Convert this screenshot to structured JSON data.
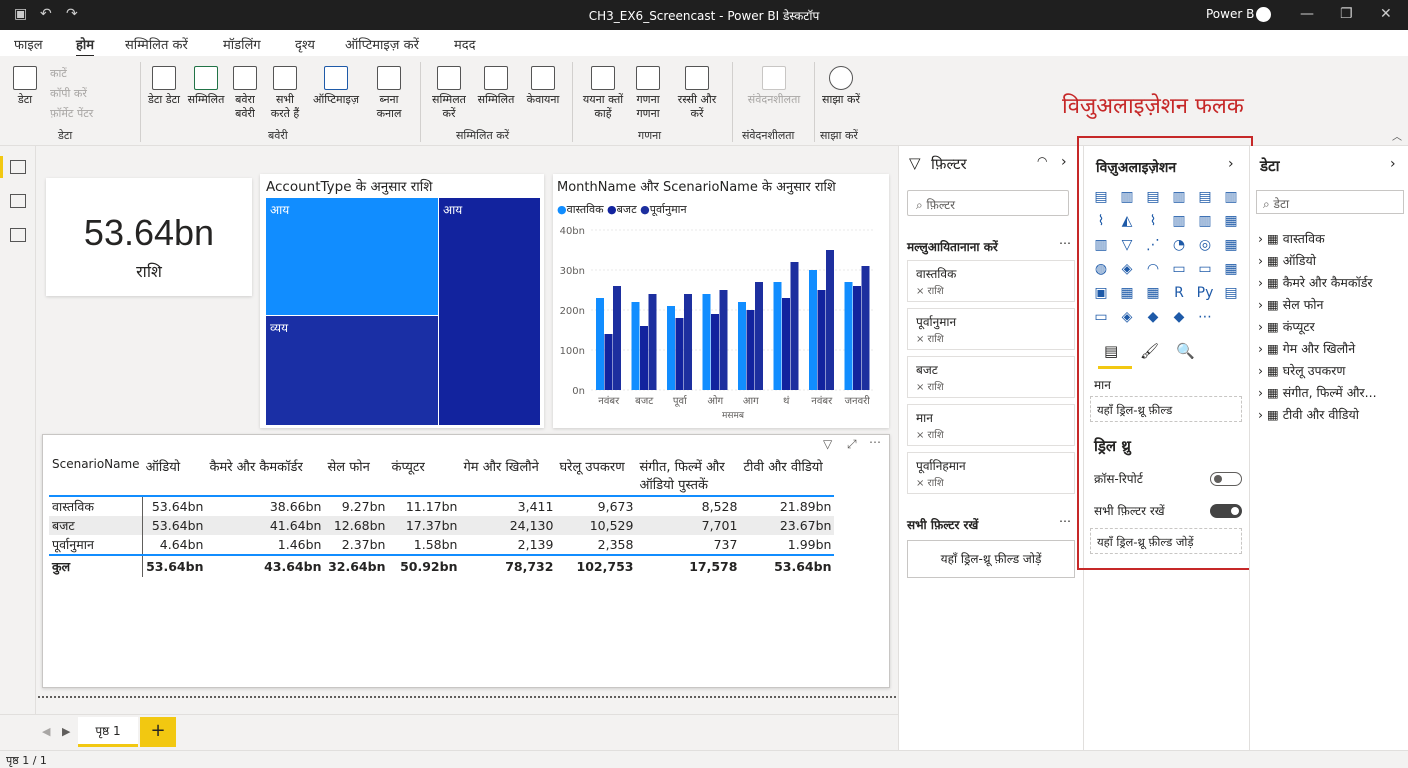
{
  "window": {
    "title": "CH3_EX6_Screencast - Power BI डेस्कटॉप",
    "user": "Power B"
  },
  "menu": [
    "फाइल",
    "होम",
    "सम्मिलित करें",
    "मॉडलिंग",
    "दृश्य",
    "ऑप्टिमाइज़ करें",
    "मदद"
  ],
  "ribbon": {
    "data_btn": "डेटा",
    "clipboard": [
      "काटें",
      "कॉपी करें",
      "फ़ॉर्मेट पेंटर"
    ],
    "data_group": "डेटा",
    "b1": "डेटा डेटा",
    "b2": "सम्मिलित",
    "b3": "बवेरा बवेरी",
    "b4": "सभी करते हैं",
    "b5": "ऑप्टिमाइज़",
    "b6": "ब्नना कनाल",
    "queries_group": "बवेरी",
    "b7": "सम्मिलत करें",
    "b8": "सम्मिलित",
    "b9": "केवायना",
    "insert_group": "सम्मिलित करें",
    "b10": "ययना क्तों काहें",
    "b11": "गणना गणना",
    "b12": "रस्सी और करें",
    "calc_group": "गणना",
    "b13": "संवेदनशीलता",
    "sens_group": "संवेदनशीलता",
    "b14": "साझा करें",
    "share_group": "साझा करें"
  },
  "annotation": "विजुअलाइज़ेशन फलक",
  "kpi": {
    "value": "53.64bn",
    "label": "राशि"
  },
  "treemap": {
    "title": "AccountType के अनुसार राशि",
    "labels": [
      "आय",
      "आय",
      "व्यय"
    ]
  },
  "chart_data": {
    "type": "bar",
    "title": "MonthName और ScenarioName के अनुसार राशि",
    "xlabel": "मसमब",
    "ylabel": "",
    "categories": [
      "नवंबर",
      "बजट",
      "पूर्वा",
      "ओग",
      "आग",
      "थं",
      "नवंबर",
      "जनवरी"
    ],
    "ylim": [
      0,
      40
    ],
    "yticks": [
      "0n",
      "100n",
      "200n",
      "30bn",
      "40bn"
    ],
    "series": [
      {
        "name": "वास्तविक",
        "color": "#118dff",
        "values": [
          23,
          22,
          21,
          24,
          22,
          27,
          30,
          27
        ]
      },
      {
        "name": "बजट",
        "color": "#12239e",
        "values": [
          14,
          16,
          18,
          19,
          20,
          23,
          25,
          26
        ]
      },
      {
        "name": "पूर्वानुमान",
        "color": "#1d2f9f",
        "values": [
          26,
          24,
          24,
          25,
          27,
          32,
          35,
          31
        ]
      }
    ]
  },
  "matrix": {
    "headers": [
      "ScenarioName",
      "ऑडियो",
      "कैमरे और कैमकॉर्डर",
      "सेल फोन",
      "कंप्यूटर",
      "गेम और खिलौने",
      "घरेलू उपकरण",
      "संगीत, फिल्में और ऑडियो पुस्तकें",
      "टीवी और वीडियो"
    ],
    "rows": [
      [
        "वास्तविक",
        "53.64bn",
        "38.66bn",
        "9.27bn",
        "11.17bn",
        "3,411",
        "9,673",
        "8,528",
        "21.89bn"
      ],
      [
        "बजट",
        "53.64bn",
        "41.64bn",
        "12.68bn",
        "17.37bn",
        "24,130",
        "10,529",
        "7,701",
        "23.67bn"
      ],
      [
        "पूर्वानुमान",
        "4.64bn",
        "1.46bn",
        "2.37bn",
        "1.58bn",
        "2,139",
        "2,358",
        "737",
        "1.99bn"
      ]
    ],
    "total": [
      "कुल",
      "53.64bn",
      "43.64bn",
      "32.64bn",
      "50.92bn",
      "78,732",
      "102,753",
      "17,578",
      "53.64bn"
    ]
  },
  "filters": {
    "title": "फ़िल्टर",
    "search": "फ़िल्टर",
    "section": "मल्लुआयितानाना करें",
    "cards": [
      {
        "name": "वास्तविक",
        "sub": "× राशि"
      },
      {
        "name": "पूर्वानुमान",
        "sub": "× राशि"
      },
      {
        "name": "बजट",
        "sub": "× राशि"
      },
      {
        "name": "मान",
        "sub": "× राशि"
      },
      {
        "name": "पूर्वानिहमान",
        "sub": "× राशि"
      }
    ],
    "all_title": "सभी फ़िल्टर रखें",
    "all_drop": "यहाँ ड्रिल-थ्रू फ़ील्ड जोड़ें"
  },
  "viz": {
    "title": "विज़ुअलाइज़ेशन",
    "values_label": "मान",
    "values_drop": "यहाँ ड्रिल-थ्रू फ़ील्ड",
    "drill_title": "ड्रिल थ्रु",
    "cross_label": "क्रॉस-रिपोर्ट",
    "keep_label": "सभी फ़िल्टर रखें",
    "drill_drop": "यहाँ ड्रिल-थ्रू फ़ील्ड जोड़ें"
  },
  "datapane": {
    "title": "डेटा",
    "search": "डेटा",
    "items": [
      "वास्तविक",
      "ऑडियो",
      "कैमरे और कैमकॉर्डर",
      "सेल फोन",
      "कंप्यूटर",
      "गेम और खिलौने",
      "घरेलू उपकरण",
      "संगीत, फिल्में और...",
      "टीवी और वीडियो"
    ]
  },
  "pages": {
    "tab": "पृष्ठ 1",
    "add": "+"
  },
  "status": "पृष्ठ 1 / 1"
}
